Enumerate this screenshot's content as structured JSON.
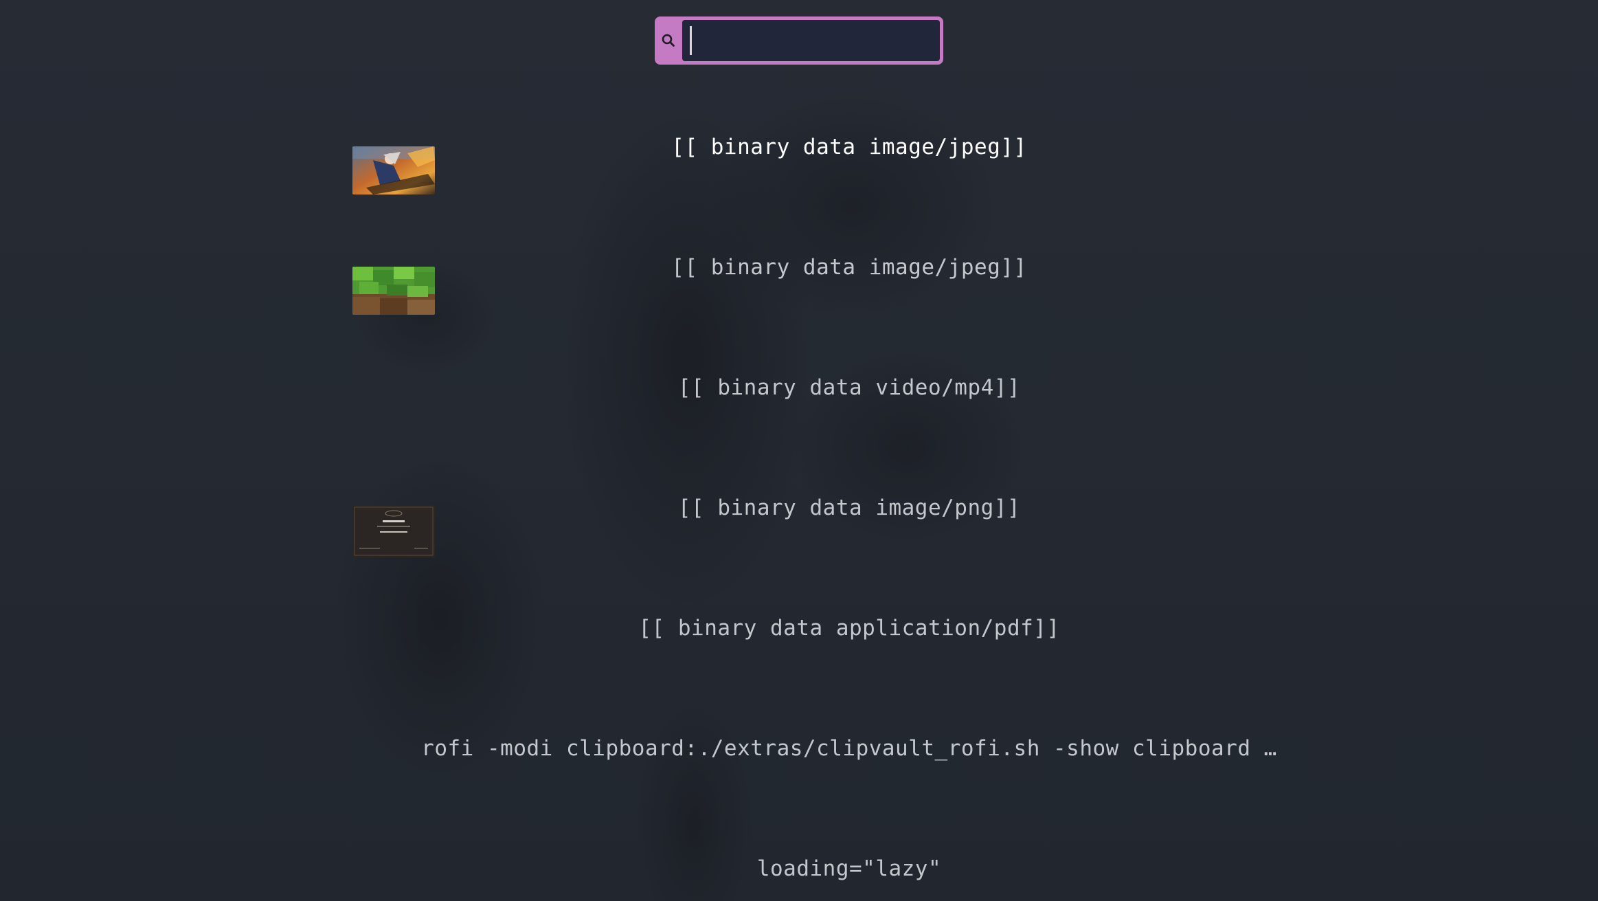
{
  "search": {
    "value": "",
    "placeholder": "",
    "icon": "search-icon"
  },
  "entries": [
    {
      "label": "[[ binary data image/jpeg]]",
      "thumbnail": "anime-artwork-thumbnail",
      "selected": true
    },
    {
      "label": "[[ binary data image/jpeg]]",
      "thumbnail": "minecraft-grass-thumbnail",
      "selected": false
    },
    {
      "label": "[[ binary data video/mp4]]",
      "thumbnail": null,
      "selected": false
    },
    {
      "label": "[[ binary data image/png]]",
      "thumbnail": "certificate-thumbnail",
      "selected": false
    },
    {
      "label": "[[ binary data application/pdf]]",
      "thumbnail": null,
      "selected": false
    },
    {
      "label": "rofi -modi clipboard:./extras/clipvault_rofi.sh -show clipboard …",
      "thumbnail": null,
      "selected": false
    },
    {
      "label": "loading=\"lazy\"",
      "thumbnail": null,
      "selected": false
    }
  ],
  "colors": {
    "background": "#252a33",
    "accent": "#c47bc3",
    "input_bg": "#22263a",
    "text": "#c4c7cc",
    "text_selected": "#ffffff"
  }
}
